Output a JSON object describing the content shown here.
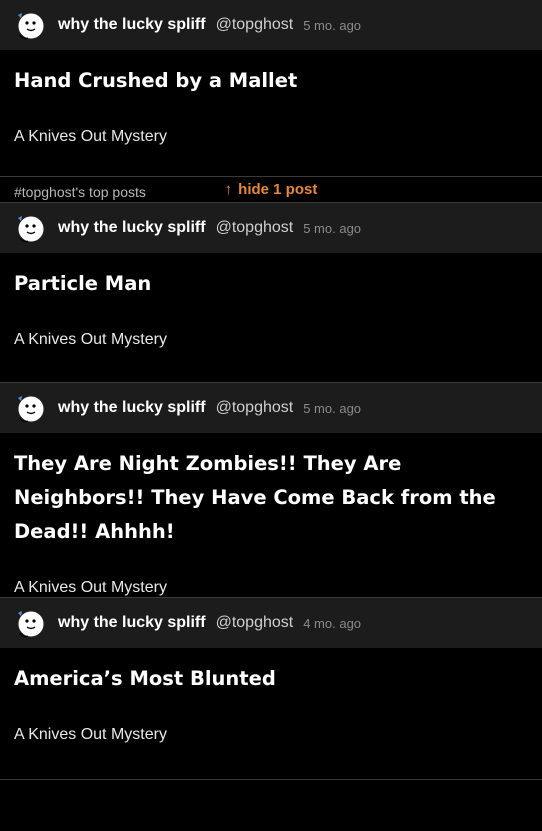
{
  "colors": {
    "background": "#000000",
    "header_background": "#1c1c1c",
    "accent": "#e8873a",
    "divider": "#3a3a3a"
  },
  "hide_bar": {
    "arrow": "↑",
    "label": "hide 1 post"
  },
  "posts": [
    {
      "display_name": "why the lucky spliff",
      "handle": "@topghost",
      "timestamp": "5 mo. ago",
      "title": "Hand Crushed by a Mallet",
      "subtitle": "A Knives Out Mystery",
      "tag": "#topghost's top posts"
    },
    {
      "display_name": "why the lucky spliff",
      "handle": "@topghost",
      "timestamp": "5 mo. ago",
      "title": "Particle Man",
      "subtitle": "A Knives Out Mystery"
    },
    {
      "display_name": "why the lucky spliff",
      "handle": "@topghost",
      "timestamp": "5 mo. ago",
      "title": "They Are Night Zombies!! They Are Neighbors!! They Have Come Back from the Dead!! Ahhhh!",
      "subtitle": "A Knives Out Mystery"
    },
    {
      "display_name": "why the lucky spliff",
      "handle": "@topghost",
      "timestamp": "4 mo. ago",
      "title": "America’s Most Blunted",
      "subtitle": "A Knives Out Mystery"
    }
  ]
}
